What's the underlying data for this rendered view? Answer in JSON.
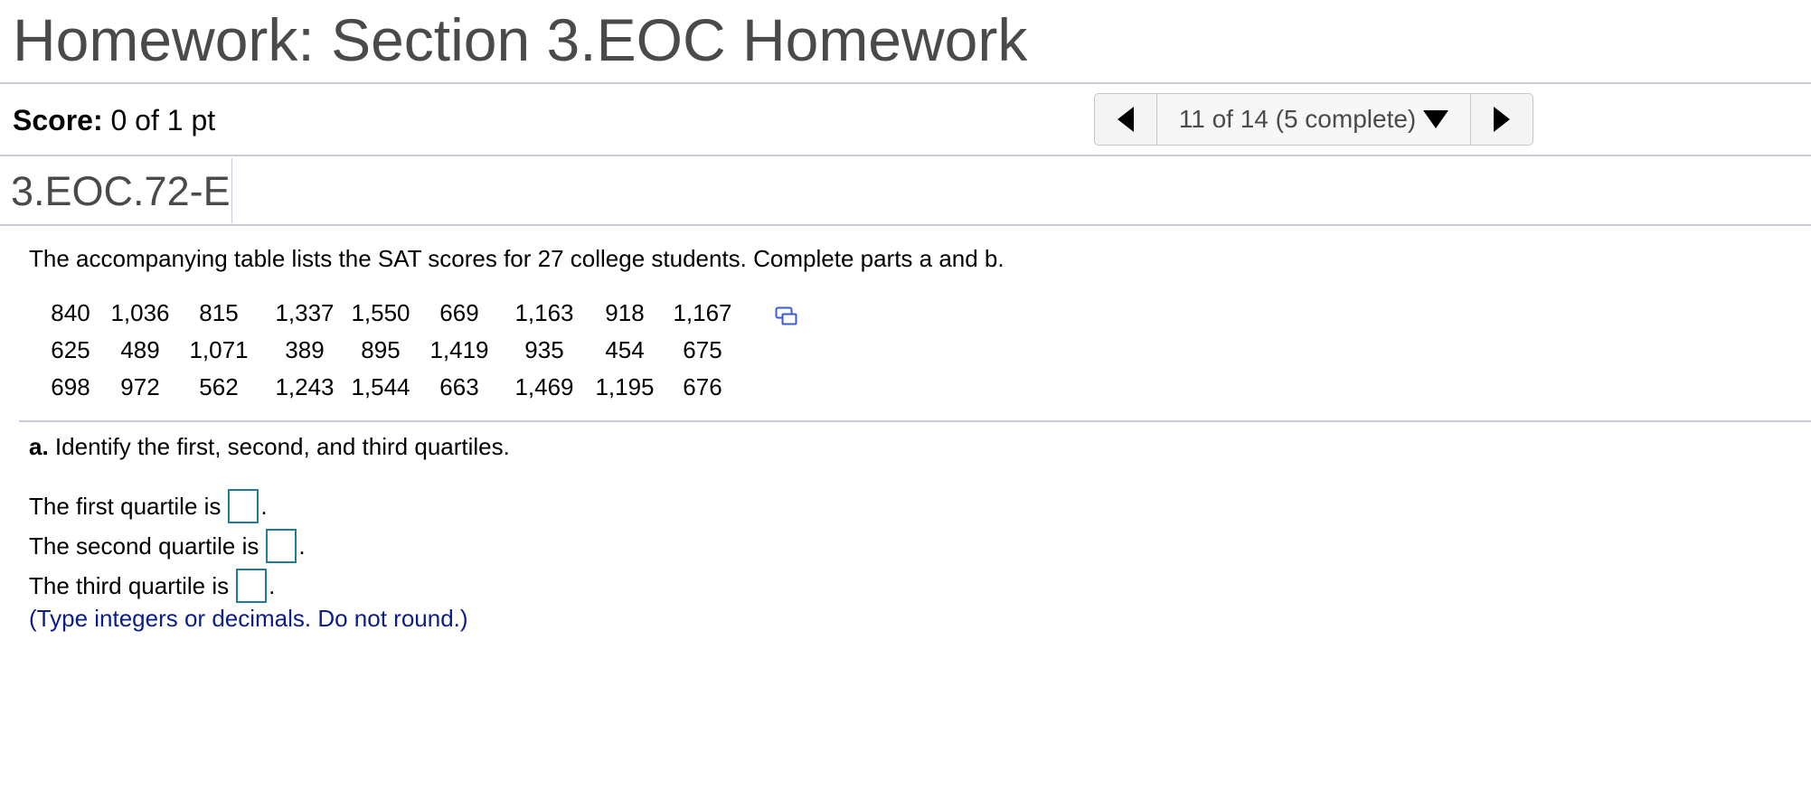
{
  "header": {
    "title": "Homework: Section 3.EOC Homework"
  },
  "score": {
    "label": "Score:",
    "value": "0 of 1 pt"
  },
  "navigator": {
    "position_text": "11 of 14 (5 complete)",
    "prev_icon": "triangle-left-icon",
    "next_icon": "triangle-right-icon",
    "dropdown_icon": "triangle-down-icon"
  },
  "question": {
    "id": "3.EOC.72-E",
    "intro": "The accompanying table lists the SAT scores for 27 college students. Complete parts a and b.",
    "data_rows": [
      [
        "840",
        "1,036",
        "815",
        "1,337",
        "1,550",
        "669",
        "1,163",
        "918",
        "1,167"
      ],
      [
        "625",
        "489",
        "1,071",
        "389",
        "895",
        "1,419",
        "935",
        "454",
        "675"
      ],
      [
        "698",
        "972",
        "562",
        "1,243",
        "1,544",
        "663",
        "1,469",
        "1,195",
        "676"
      ]
    ],
    "copy_icon": "copy-data-icon"
  },
  "part_a": {
    "label": "a.",
    "prompt": "Identify the first, second, and third quartiles.",
    "lines": [
      {
        "text": "The first quartile is",
        "value": "",
        "suffix": "."
      },
      {
        "text": "The second quartile is",
        "value": "",
        "suffix": "."
      },
      {
        "text": "The third quartile is",
        "value": "",
        "suffix": "."
      }
    ],
    "hint": "(Type integers or decimals. Do not round.)"
  },
  "colors": {
    "title_text": "#4a4a4a",
    "divider": "#c9cbdb",
    "answer_box_border": "#1f7a9d",
    "hint_text": "#0b1d8a",
    "copy_icon": "#3b5bd6"
  }
}
